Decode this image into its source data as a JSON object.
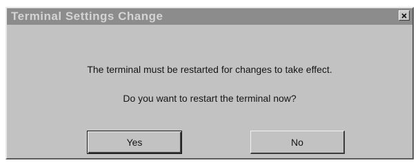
{
  "dialog": {
    "title": "Terminal Settings Change",
    "message_line1": "The terminal must be restarted for changes to take effect.",
    "message_line2": "Do you want to restart the terminal now?",
    "buttons": {
      "yes_label": "Yes",
      "no_label": "No"
    }
  },
  "icons": {
    "close": "close-icon"
  }
}
